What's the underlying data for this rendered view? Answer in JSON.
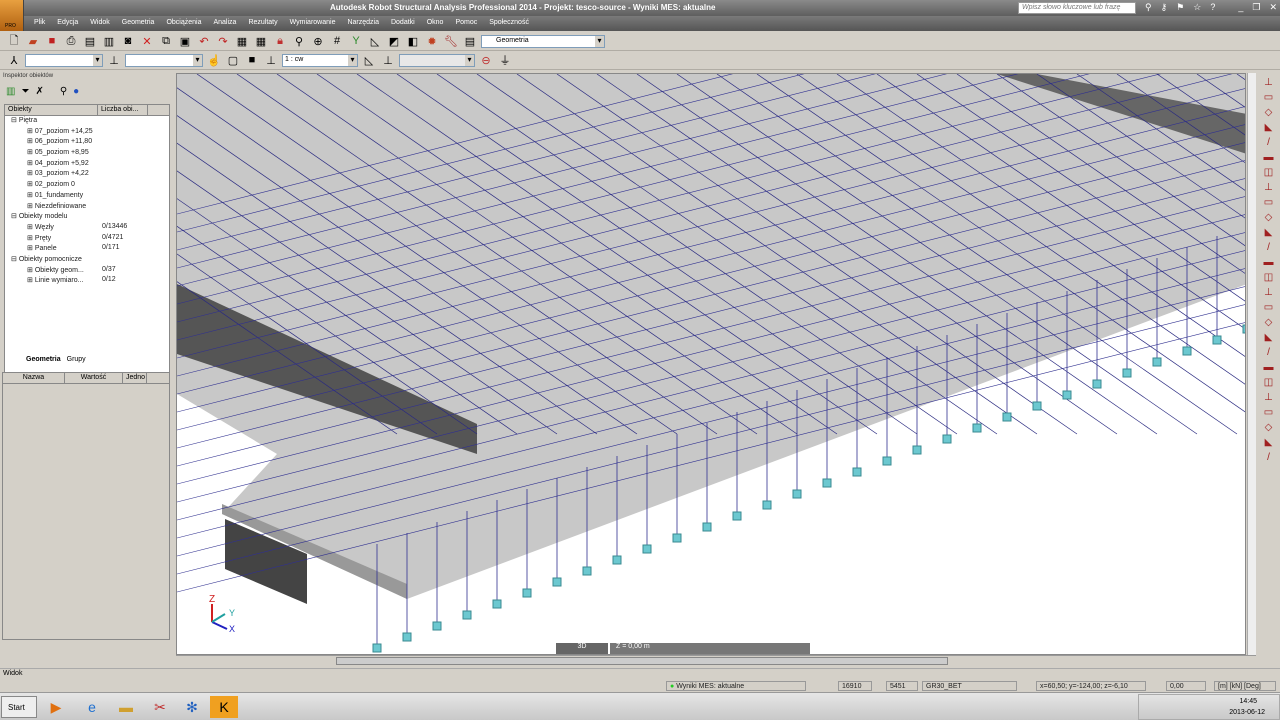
{
  "app": {
    "title": "Autodesk Robot Structural Analysis Professional 2014 - Projekt: tesco-source - Wyniki MES: aktualne",
    "logo_text": "PRO",
    "search_placeholder": "Wpisz słowo kluczowe lub frazę"
  },
  "menu": [
    "Plik",
    "Edycja",
    "Widok",
    "Geometria",
    "Obciążenia",
    "Analiza",
    "Rezultaty",
    "Wymiarowanie",
    "Narzędzia",
    "Dodatki",
    "Okno",
    "Pomoc",
    "Społeczność"
  ],
  "toolbar": {
    "layout_combo": "Geometria",
    "case_combo": "1 : cw"
  },
  "inspector": {
    "title": "Inspektor obiektów",
    "col_objects": "Obiekty",
    "col_count": "Liczba obi...",
    "tree": [
      {
        "label": "Piętra",
        "count": "",
        "level": 0
      },
      {
        "label": "07_poziom +14,25",
        "count": "",
        "level": 1
      },
      {
        "label": "06_poziom +11,80",
        "count": "",
        "level": 1
      },
      {
        "label": "05_poziom +8,95",
        "count": "",
        "level": 1
      },
      {
        "label": "04_poziom +5,92",
        "count": "",
        "level": 1
      },
      {
        "label": "03_poziom +4,22",
        "count": "",
        "level": 1
      },
      {
        "label": "02_poziom 0",
        "count": "",
        "level": 1
      },
      {
        "label": "01_fundamenty",
        "count": "",
        "level": 1
      },
      {
        "label": "Niezdefiniowane",
        "count": "",
        "level": 1
      },
      {
        "label": "Obiekty modelu",
        "count": "",
        "level": 0
      },
      {
        "label": "Węzły",
        "count": "0/13446",
        "level": 1
      },
      {
        "label": "Pręty",
        "count": "0/4721",
        "level": 1
      },
      {
        "label": "Panele",
        "count": "0/171",
        "level": 1
      },
      {
        "label": "Obiekty pomocnicze",
        "count": "",
        "level": 0
      },
      {
        "label": "Obiekty geom...",
        "count": "0/37",
        "level": 1
      },
      {
        "label": "Linie wymiaro...",
        "count": "0/12",
        "level": 1
      }
    ],
    "tabs": [
      "Geometria",
      "Grupy"
    ],
    "props_cols": [
      "Nazwa",
      "Wartość",
      "Jedno"
    ]
  },
  "viewport": {
    "tab_3d": "3D",
    "z_level": "Z = 0,00 m",
    "axes": [
      "X",
      "Y",
      "Z"
    ]
  },
  "status": {
    "view_label": "Widok",
    "results": "Wyniki MES: aktualne",
    "nodes": "16910",
    "bars": "5451",
    "material": "GR30_BET",
    "coords": "x=60,50; y=-124,00; z=-6,10",
    "angle": "0,00",
    "units": "[m] [kN] [Deg]"
  },
  "taskbar": {
    "start": "Start",
    "time": "14:45",
    "date": "2013-06-12"
  }
}
